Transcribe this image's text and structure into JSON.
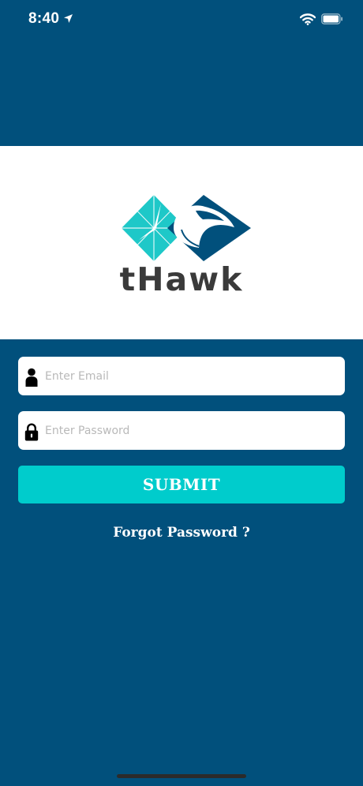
{
  "status_bar": {
    "time": "8:40",
    "icons": [
      "location-arrow-icon",
      "wifi-icon",
      "battery-icon"
    ]
  },
  "logo": {
    "brand_name": "tHawk",
    "colors": {
      "teal": "#1ec8c8",
      "navy": "#01507c",
      "text": "#3a3a3a"
    }
  },
  "form": {
    "email": {
      "placeholder": "Enter Email",
      "value": "",
      "icon": "user-icon"
    },
    "password": {
      "placeholder": "Enter Password",
      "value": "",
      "icon": "lock-icon"
    },
    "submit_label": "SUBMIT",
    "forgot_label": "Forgot Password ?"
  },
  "colors": {
    "background": "#01507c",
    "accent": "#00cccc",
    "field_bg": "#ffffff"
  }
}
